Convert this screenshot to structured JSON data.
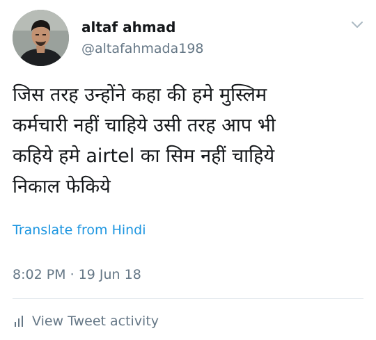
{
  "tweet": {
    "author": {
      "name": "altaf ahmad",
      "handle": "@altafahmada198"
    },
    "text_lines": [
      "जिस तरह उन्होंने कहा की हमे मुस्लिम",
      "कर्मचारी नहीं चाहिये उसी तरह आप भी",
      "कहिये हमे airtel का सिम नहीं चाहिये",
      "निकाल फेकिये"
    ],
    "translate_label": "Translate from Hindi",
    "timestamp": "8:02 PM · 19 Jun 18",
    "activity_label": "View Tweet activity"
  },
  "icons": {
    "menu": "chevron-down-icon",
    "activity": "bar-chart-icon",
    "avatar": "profile-photo"
  },
  "colors": {
    "text": "#14171a",
    "secondary": "#657786",
    "link": "#1b95e0",
    "divider": "#e1e8ed"
  }
}
